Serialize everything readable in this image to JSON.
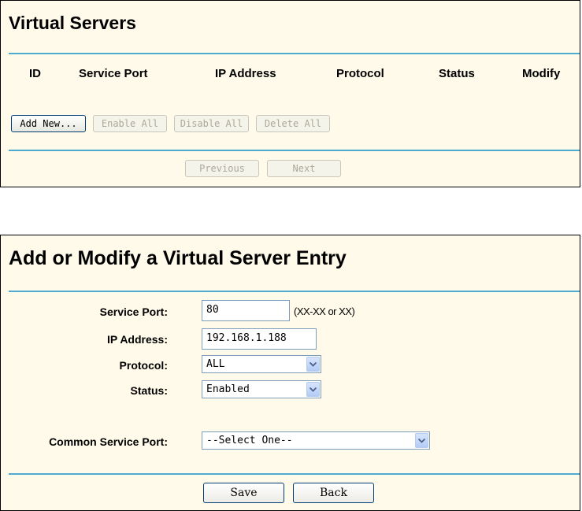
{
  "virtual_servers": {
    "title": "Virtual Servers",
    "columns": [
      "ID",
      "Service Port",
      "IP Address",
      "Protocol",
      "Status",
      "Modify"
    ],
    "buttons": {
      "add_new": "Add New...",
      "enable_all": "Enable All",
      "disable_all": "Disable All",
      "delete_all": "Delete All",
      "previous": "Previous",
      "next": "Next"
    }
  },
  "entry_form": {
    "title": "Add or Modify a Virtual Server Entry",
    "fields": {
      "service_port": {
        "label": "Service Port:",
        "value": "80",
        "hint": "(XX-XX or XX)"
      },
      "ip_address": {
        "label": "IP Address:",
        "value": "192.168.1.188"
      },
      "protocol": {
        "label": "Protocol:",
        "value": "ALL"
      },
      "status": {
        "label": "Status:",
        "value": "Enabled"
      },
      "common_service_port": {
        "label": "Common Service Port:",
        "value": "--Select One--"
      }
    },
    "buttons": {
      "save": "Save",
      "back": "Back"
    }
  },
  "colors": {
    "accent_rule": "#4eaad0",
    "panel_bg": "#fffae9"
  }
}
